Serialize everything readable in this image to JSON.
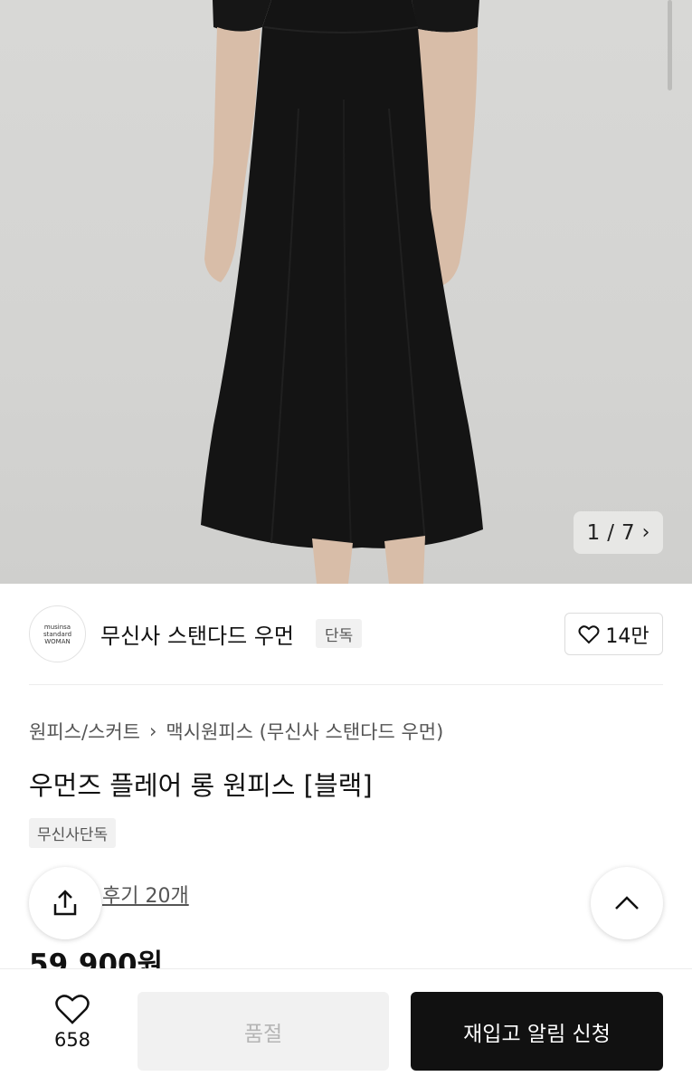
{
  "gallery": {
    "current": "1",
    "separator": "/",
    "total": "7"
  },
  "brand": {
    "logo_lines": [
      "musinsa",
      "standard",
      "WOMAN"
    ],
    "name": "무신사 스탠다드 우먼",
    "tag": "단독",
    "likes": "14만"
  },
  "breadcrumb": {
    "category": "원피스/스커트",
    "subcategory": "맥시원피스 (무신사 스탠다드 우먼)"
  },
  "product": {
    "title": "우먼즈 플레어 롱 원피스 [블랙]",
    "exclusive_tag": "무신사단독",
    "reviews": "후기 20개",
    "price": "59,900원"
  },
  "bottom_bar": {
    "wish_count": "658",
    "soldout_label": "품절",
    "restock_label": "재입고 알림 신청"
  },
  "colors": {
    "dress": "#141414",
    "skin": "#dcc2ae",
    "background": "#d6d6d4",
    "accent": "#111111"
  }
}
